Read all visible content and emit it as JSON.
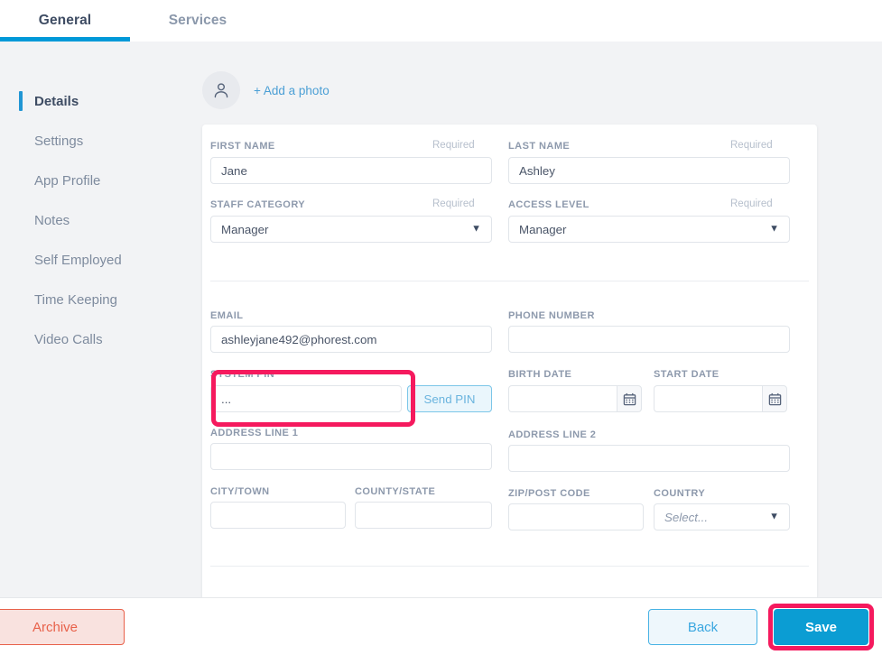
{
  "tabs": [
    {
      "label": "General",
      "active": true
    },
    {
      "label": "Services",
      "active": false
    }
  ],
  "sidebar": {
    "items": [
      {
        "label": "Details",
        "active": true
      },
      {
        "label": "Settings",
        "active": false
      },
      {
        "label": "App Profile",
        "active": false
      },
      {
        "label": "Notes",
        "active": false
      },
      {
        "label": "Self Employed",
        "active": false
      },
      {
        "label": "Time Keeping",
        "active": false
      },
      {
        "label": "Video Calls",
        "active": false
      }
    ]
  },
  "photo": {
    "add_label": "+ Add a photo",
    "avatar_icon": "person-icon"
  },
  "form": {
    "required_label": "Required",
    "first_name": {
      "label": "FIRST NAME",
      "value": "Jane",
      "required": "Required"
    },
    "last_name": {
      "label": "LAST NAME",
      "value": "Ashley",
      "required": "Required"
    },
    "staff_category": {
      "label": "STAFF CATEGORY",
      "value": "Manager",
      "required": "Required"
    },
    "access_level": {
      "label": "ACCESS LEVEL",
      "value": "Manager",
      "required": "Required"
    },
    "email": {
      "label": "EMAIL",
      "value": "ashleyjane492@phorest.com"
    },
    "phone_number": {
      "label": "PHONE NUMBER",
      "value": ""
    },
    "system_pin": {
      "label": "SYSTEM PIN",
      "value": "..."
    },
    "send_pin_button": "Send PIN",
    "birth_date": {
      "label": "BIRTH DATE",
      "value": ""
    },
    "start_date": {
      "label": "START DATE",
      "value": ""
    },
    "address_line_1": {
      "label": "ADDRESS LINE 1",
      "value": ""
    },
    "address_line_2": {
      "label": "ADDRESS LINE 2",
      "value": ""
    },
    "city_town": {
      "label": "CITY/TOWN",
      "value": ""
    },
    "county_state": {
      "label": "COUNTY/STATE",
      "value": ""
    },
    "zip_post_code": {
      "label": "ZIP/POST CODE",
      "value": ""
    },
    "country": {
      "label": "COUNTRY",
      "value": "Select...",
      "placeholder": "Select..."
    }
  },
  "footer": {
    "archive": "Archive",
    "back": "Back",
    "save": "Save"
  },
  "colors": {
    "accent_blue": "#0099d8",
    "highlight_pink": "#f51a5e",
    "archive_red": "#e8614a",
    "label_gray": "#8d99ac"
  },
  "highlights": [
    {
      "target": "system-pin-field",
      "color": "#f51a5e"
    },
    {
      "target": "save-button",
      "color": "#f51a5e"
    }
  ]
}
